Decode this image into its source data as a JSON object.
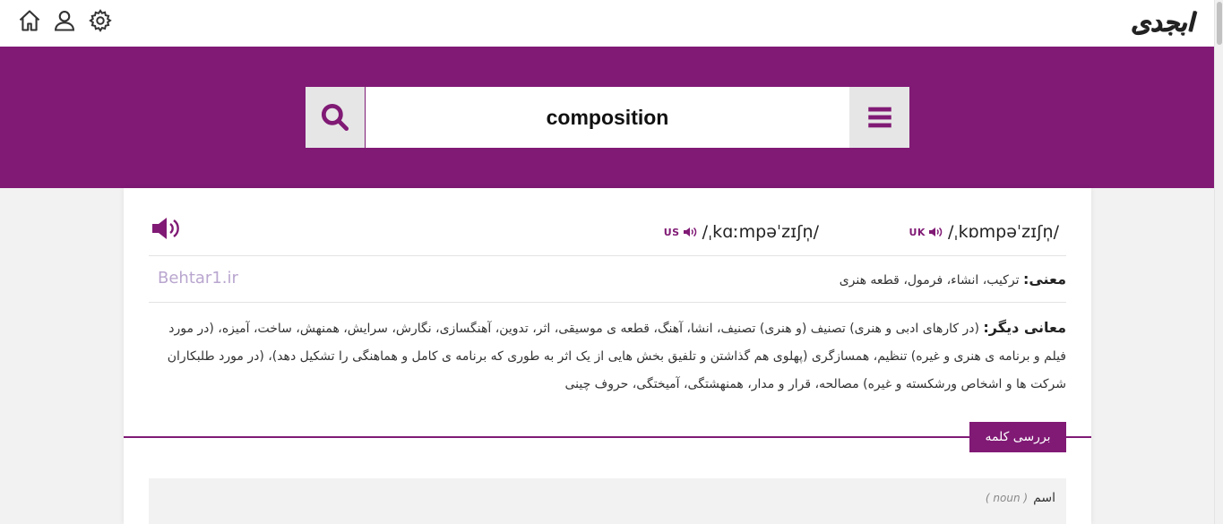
{
  "header": {
    "logo_text": "ابجدی",
    "icons": [
      "home-icon",
      "user-icon",
      "gear-icon"
    ]
  },
  "search": {
    "value": "composition",
    "icon": "search-icon",
    "menu_icon": "menu-icon"
  },
  "pronunciation": {
    "uk_tag": "UK",
    "uk_ipa": "/ˌkɒmpəˈzɪʃn̩/",
    "us_tag": "US",
    "us_ipa": "/ˌkɑːmpəˈzɪʃn̩/"
  },
  "meaning": {
    "label": "معنی:",
    "text": " ترکیب، انشاء، فرمول، قطعه هنری"
  },
  "watermark": "Behtar1.ir",
  "other_meanings": {
    "label": "معانی دیگر:",
    "text": " (در کارهای ادبی و هنری) تصنیف (و هنری) تصنیف، انشا، آهنگ، قطعه ی موسیقی، اثر، تدوین، آهنگسازی، نگارش، سرایش، همنهش، ساخت، آمیزه، (در مورد فیلم و برنامه ی هنری و غیره) تنظیم، همسازگری (پهلوی هم گذاشتن و تلفیق بخش هایی از یک اثر به طوری که برنامه ی کامل و هماهنگی را تشکیل دهد)، (در مورد طلبکاران شرکت ها و اشخاص ورشکسته و غیره) مصالحه، قرار و مدار، همنهشتگی، آمیختگی، حروف چینی"
  },
  "section": {
    "label": "بررسی کلمه"
  },
  "part_of_speech": {
    "label": "اسم",
    "english": "( noun )"
  },
  "colors": {
    "brand": "#801a75",
    "button_bg": "#e6e6e6"
  }
}
